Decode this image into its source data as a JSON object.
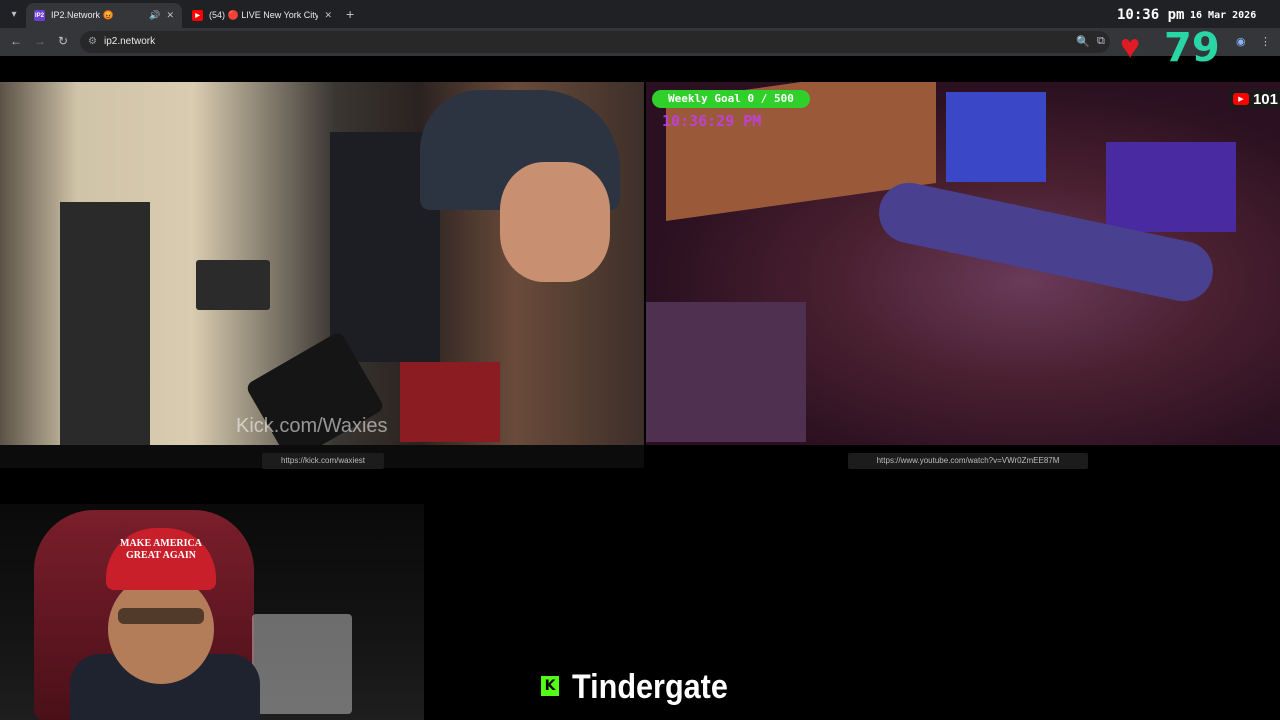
{
  "tabs": [
    {
      "title": "IP2.Network",
      "favicon": "IP2",
      "icon_after": "😡",
      "active": true,
      "audio_icon": "speaker-icon"
    },
    {
      "title": "(54) 🔴 LIVE New York City 🗽",
      "favicon": "youtube-icon",
      "active": false
    }
  ],
  "address_bar": {
    "url": "ip2.network"
  },
  "overlay": {
    "time": "10:36 pm",
    "date": "16 Mar 2026",
    "heart_rate": "79"
  },
  "left_stream": {
    "watermark": "Kick.com/Waxies",
    "source_url": "https://kick.com/waxiest"
  },
  "right_stream": {
    "goal_label": "Weekly Goal 0 / 500",
    "clock": "10:36:29 PM",
    "viewer_count": "101",
    "source_url": "https://www.youtube.com/watch?v=VWr0ZmEE87M"
  },
  "webcam": {
    "hat_text": "MAKE AMERICA GREAT AGAIN"
  },
  "ticker": {
    "platform_icon": "K",
    "text": "Tindergate"
  },
  "colors": {
    "heart": "#e01b24",
    "heart_rate": "#28d6a6",
    "goal_badge": "#2fd02a",
    "kick_green": "#53fc18",
    "youtube_red": "#ff0000"
  }
}
